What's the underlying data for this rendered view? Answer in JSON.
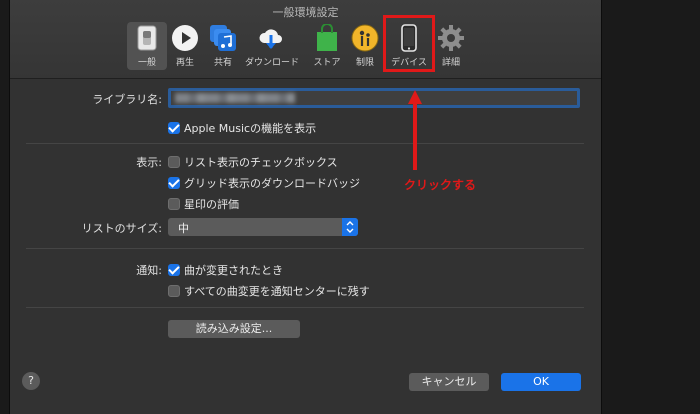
{
  "window": {
    "title": "一般環境設定"
  },
  "toolbar": {
    "items": [
      {
        "label": "一般",
        "icon": "switch-icon"
      },
      {
        "label": "再生",
        "icon": "play-icon"
      },
      {
        "label": "共有",
        "icon": "shared-music-icon"
      },
      {
        "label": "ダウンロード",
        "icon": "cloud-download-icon"
      },
      {
        "label": "ストア",
        "icon": "store-bag-icon"
      },
      {
        "label": "制限",
        "icon": "parental-restriction-icon"
      },
      {
        "label": "デバイス",
        "icon": "iphone-device-icon"
      },
      {
        "label": "詳細",
        "icon": "gear-icon"
      }
    ],
    "active": "一般",
    "highlighted": "デバイス"
  },
  "library": {
    "name_label": "ライブラリ名:",
    "name_value": "",
    "apple_music_label": "Apple Musicの機能を表示",
    "apple_music_checked": true
  },
  "display": {
    "label": "表示:",
    "options": [
      {
        "label": "リスト表示のチェックボックス",
        "checked": false
      },
      {
        "label": "グリッド表示のダウンロードバッジ",
        "checked": true
      },
      {
        "label": "星印の評価",
        "checked": false
      }
    ]
  },
  "list_size": {
    "label": "リストのサイズ:",
    "value": "中"
  },
  "notifications": {
    "label": "通知:",
    "options": [
      {
        "label": "曲が変更されたとき",
        "checked": true
      },
      {
        "label": "すべての曲変更を通知センターに残す",
        "checked": false
      }
    ]
  },
  "import_button": "読み込み設定...",
  "help": "?",
  "buttons": {
    "cancel": "キャンセル",
    "ok": "OK"
  },
  "annotation": {
    "text": "クリックする",
    "color": "#e01919"
  },
  "colors": {
    "accent": "#1a73e8",
    "window_bg": "#323232"
  }
}
